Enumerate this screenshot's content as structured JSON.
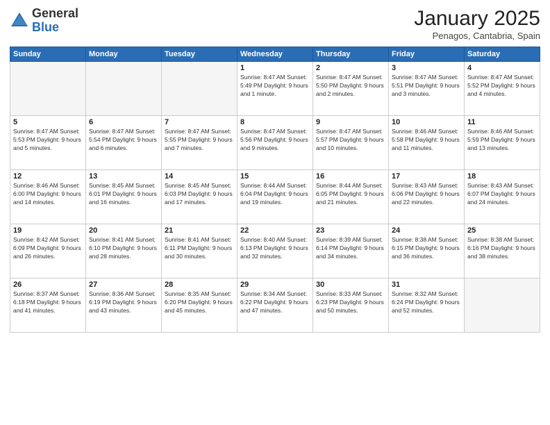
{
  "logo": {
    "general": "General",
    "blue": "Blue"
  },
  "title": "January 2025",
  "subtitle": "Penagos, Cantabria, Spain",
  "days_header": [
    "Sunday",
    "Monday",
    "Tuesday",
    "Wednesday",
    "Thursday",
    "Friday",
    "Saturday"
  ],
  "weeks": [
    [
      {
        "day": "",
        "info": ""
      },
      {
        "day": "",
        "info": ""
      },
      {
        "day": "",
        "info": ""
      },
      {
        "day": "1",
        "info": "Sunrise: 8:47 AM\nSunset: 5:49 PM\nDaylight: 9 hours\nand 1 minute."
      },
      {
        "day": "2",
        "info": "Sunrise: 8:47 AM\nSunset: 5:50 PM\nDaylight: 9 hours\nand 2 minutes."
      },
      {
        "day": "3",
        "info": "Sunrise: 8:47 AM\nSunset: 5:51 PM\nDaylight: 9 hours\nand 3 minutes."
      },
      {
        "day": "4",
        "info": "Sunrise: 8:47 AM\nSunset: 5:52 PM\nDaylight: 9 hours\nand 4 minutes."
      }
    ],
    [
      {
        "day": "5",
        "info": "Sunrise: 8:47 AM\nSunset: 5:53 PM\nDaylight: 9 hours\nand 5 minutes."
      },
      {
        "day": "6",
        "info": "Sunrise: 8:47 AM\nSunset: 5:54 PM\nDaylight: 9 hours\nand 6 minutes."
      },
      {
        "day": "7",
        "info": "Sunrise: 8:47 AM\nSunset: 5:55 PM\nDaylight: 9 hours\nand 7 minutes."
      },
      {
        "day": "8",
        "info": "Sunrise: 8:47 AM\nSunset: 5:56 PM\nDaylight: 9 hours\nand 9 minutes."
      },
      {
        "day": "9",
        "info": "Sunrise: 8:47 AM\nSunset: 5:57 PM\nDaylight: 9 hours\nand 10 minutes."
      },
      {
        "day": "10",
        "info": "Sunrise: 8:46 AM\nSunset: 5:58 PM\nDaylight: 9 hours\nand 11 minutes."
      },
      {
        "day": "11",
        "info": "Sunrise: 8:46 AM\nSunset: 5:59 PM\nDaylight: 9 hours\nand 13 minutes."
      }
    ],
    [
      {
        "day": "12",
        "info": "Sunrise: 8:46 AM\nSunset: 6:00 PM\nDaylight: 9 hours\nand 14 minutes."
      },
      {
        "day": "13",
        "info": "Sunrise: 8:45 AM\nSunset: 6:01 PM\nDaylight: 9 hours\nand 16 minutes."
      },
      {
        "day": "14",
        "info": "Sunrise: 8:45 AM\nSunset: 6:03 PM\nDaylight: 9 hours\nand 17 minutes."
      },
      {
        "day": "15",
        "info": "Sunrise: 8:44 AM\nSunset: 6:04 PM\nDaylight: 9 hours\nand 19 minutes."
      },
      {
        "day": "16",
        "info": "Sunrise: 8:44 AM\nSunset: 6:05 PM\nDaylight: 9 hours\nand 21 minutes."
      },
      {
        "day": "17",
        "info": "Sunrise: 8:43 AM\nSunset: 6:06 PM\nDaylight: 9 hours\nand 22 minutes."
      },
      {
        "day": "18",
        "info": "Sunrise: 8:43 AM\nSunset: 6:07 PM\nDaylight: 9 hours\nand 24 minutes."
      }
    ],
    [
      {
        "day": "19",
        "info": "Sunrise: 8:42 AM\nSunset: 6:09 PM\nDaylight: 9 hours\nand 26 minutes."
      },
      {
        "day": "20",
        "info": "Sunrise: 8:41 AM\nSunset: 6:10 PM\nDaylight: 9 hours\nand 28 minutes."
      },
      {
        "day": "21",
        "info": "Sunrise: 8:41 AM\nSunset: 6:11 PM\nDaylight: 9 hours\nand 30 minutes."
      },
      {
        "day": "22",
        "info": "Sunrise: 8:40 AM\nSunset: 6:13 PM\nDaylight: 9 hours\nand 32 minutes."
      },
      {
        "day": "23",
        "info": "Sunrise: 8:39 AM\nSunset: 6:14 PM\nDaylight: 9 hours\nand 34 minutes."
      },
      {
        "day": "24",
        "info": "Sunrise: 8:38 AM\nSunset: 6:15 PM\nDaylight: 9 hours\nand 36 minutes."
      },
      {
        "day": "25",
        "info": "Sunrise: 8:38 AM\nSunset: 6:16 PM\nDaylight: 9 hours\nand 38 minutes."
      }
    ],
    [
      {
        "day": "26",
        "info": "Sunrise: 8:37 AM\nSunset: 6:18 PM\nDaylight: 9 hours\nand 41 minutes."
      },
      {
        "day": "27",
        "info": "Sunrise: 8:36 AM\nSunset: 6:19 PM\nDaylight: 9 hours\nand 43 minutes."
      },
      {
        "day": "28",
        "info": "Sunrise: 8:35 AM\nSunset: 6:20 PM\nDaylight: 9 hours\nand 45 minutes."
      },
      {
        "day": "29",
        "info": "Sunrise: 8:34 AM\nSunset: 6:22 PM\nDaylight: 9 hours\nand 47 minutes."
      },
      {
        "day": "30",
        "info": "Sunrise: 8:33 AM\nSunset: 6:23 PM\nDaylight: 9 hours\nand 50 minutes."
      },
      {
        "day": "31",
        "info": "Sunrise: 8:32 AM\nSunset: 6:24 PM\nDaylight: 9 hours\nand 52 minutes."
      },
      {
        "day": "",
        "info": ""
      }
    ]
  ]
}
